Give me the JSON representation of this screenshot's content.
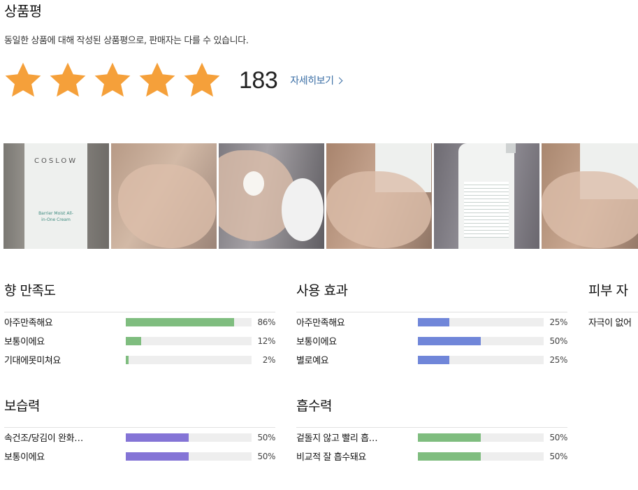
{
  "title": "상품평",
  "subtitle": "동일한 상품에 대해 작성된 상품평으로, 판매자는 다를 수 있습니다.",
  "rating": {
    "stars": 5,
    "count": "183",
    "more_label": "자세히보기"
  },
  "photos": {
    "product_brand": "COSLOW",
    "product_name": "Barrier Moist All-in-One Cream"
  },
  "colors": {
    "star": "#f5a03a",
    "green": "#7fbd7f",
    "blue": "#7086d9",
    "purple": "#8474d6",
    "link": "#3a6ea5"
  },
  "surveys": [
    {
      "title": "향 만족도",
      "rows": [
        {
          "label": "아주만족해요",
          "pct": "86%",
          "value": 0.86,
          "color": "#7fbd7f"
        },
        {
          "label": "보통이에요",
          "pct": "12%",
          "value": 0.12,
          "color": "#7fbd7f"
        },
        {
          "label": "기대에못미쳐요",
          "pct": "2%",
          "value": 0.02,
          "color": "#7fbd7f"
        }
      ]
    },
    {
      "title": "사용 효과",
      "rows": [
        {
          "label": "아주만족해요",
          "pct": "25%",
          "value": 0.25,
          "color": "#7086d9"
        },
        {
          "label": "보통이에요",
          "pct": "50%",
          "value": 0.5,
          "color": "#7086d9"
        },
        {
          "label": "별로예요",
          "pct": "25%",
          "value": 0.25,
          "color": "#7086d9"
        }
      ]
    },
    {
      "title": "피부 자",
      "rows": [
        {
          "label": "자극이 없어",
          "pct": "",
          "value": null,
          "color": ""
        }
      ]
    },
    {
      "title": "보습력",
      "rows": [
        {
          "label": "속건조/당김이 완화…",
          "pct": "50%",
          "value": 0.5,
          "color": "#8474d6"
        },
        {
          "label": "보통이에요",
          "pct": "50%",
          "value": 0.5,
          "color": "#8474d6"
        }
      ]
    },
    {
      "title": "흡수력",
      "rows": [
        {
          "label": "겉돌지 않고 빨리 흡…",
          "pct": "50%",
          "value": 0.5,
          "color": "#7fbd7f"
        },
        {
          "label": "비교적 잘 흡수돼요",
          "pct": "50%",
          "value": 0.5,
          "color": "#7fbd7f"
        }
      ]
    }
  ]
}
